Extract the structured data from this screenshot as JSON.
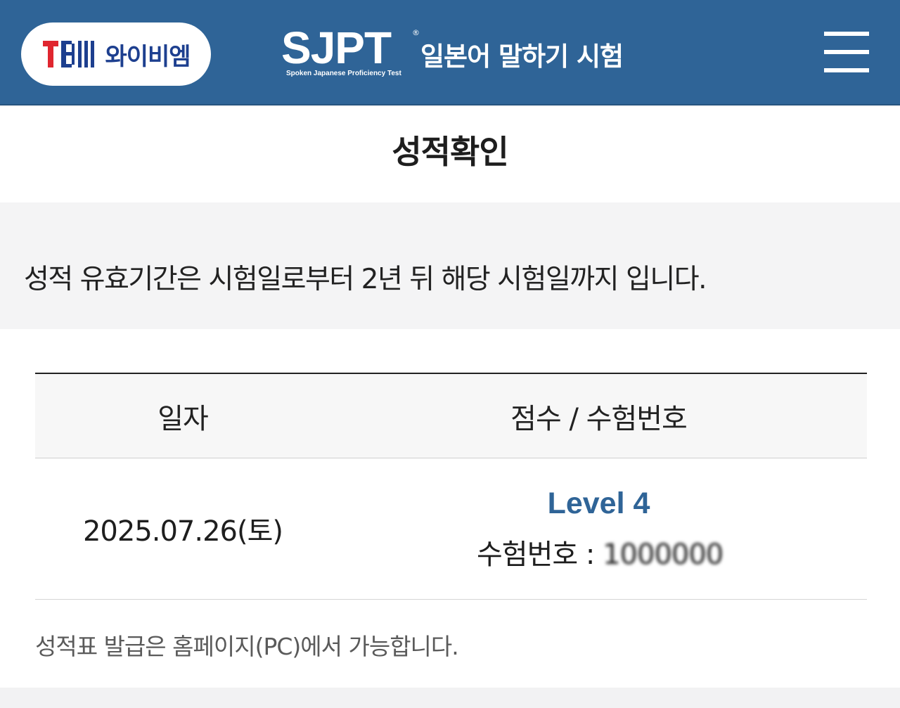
{
  "header": {
    "brand_text": "와이비엠",
    "logo_mark": "YBM",
    "product_name": "SJPT",
    "registered_mark": "®",
    "product_subtitle": "Spoken Japanese Proficiency Test",
    "product_title": "일본어 말하기 시험",
    "menu_icon": "hamburger-menu-icon",
    "background_color": "#2f6497",
    "brand_color": "#1d3f8f",
    "ybm_red": "#e0262f"
  },
  "page": {
    "title": "성적확인"
  },
  "notice": {
    "text": "성적 유효기간은 시험일로부터 2년 뒤 해당 시험일까지 입니다."
  },
  "table": {
    "headers": {
      "date": "일자",
      "score": "점수 / 수험번호"
    },
    "rows": [
      {
        "date": "2025.07.26(토)",
        "level": "Level 4",
        "exam_label": "수험번호 : ",
        "exam_number": "1000000"
      }
    ],
    "level_color": "#2f6497"
  },
  "footnote": "성적표 발급은 홈페이지(PC)에서 가능합니다."
}
